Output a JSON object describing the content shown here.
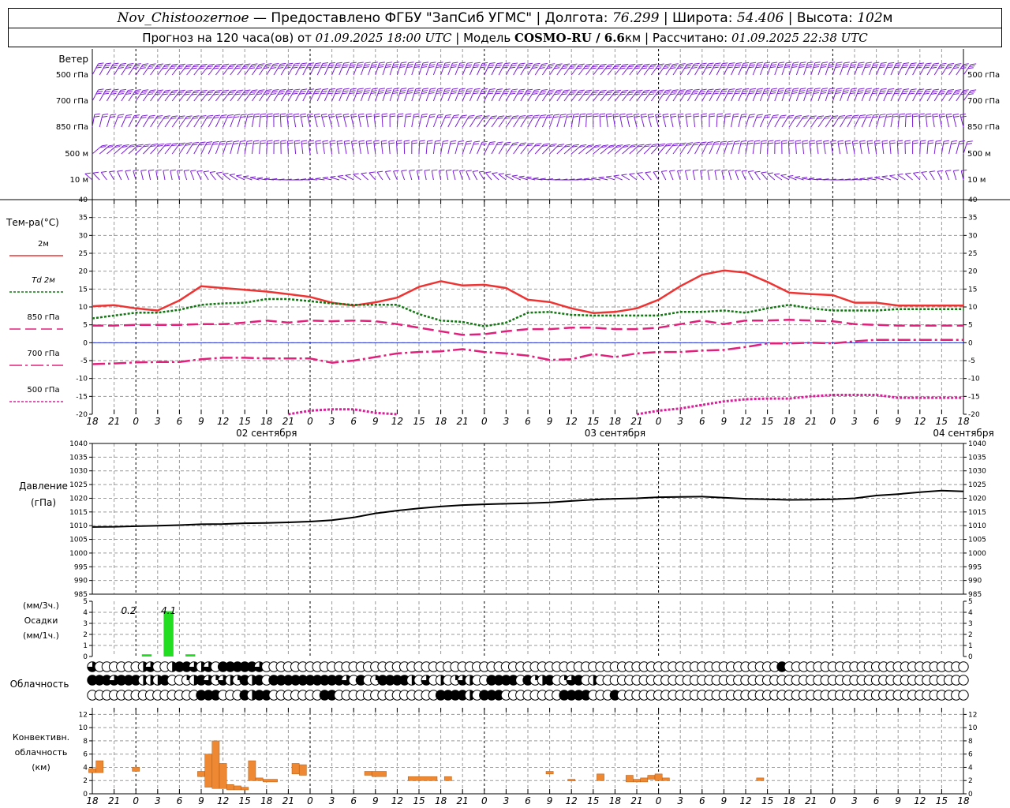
{
  "header": {
    "station": "Nov_Chistoozernoe",
    "provider": "— Предоставлено ФГБУ \"ЗапСиб УГМС\"",
    "lon_label": "Долгота:",
    "lon_value": "76.299",
    "lat_label": "Широта:",
    "lat_value": "54.406",
    "alt_label": "Высота:",
    "alt_value": "102",
    "alt_unit": "м",
    "forecast_label": "Прогноз на 120 часа(ов) от",
    "forecast_time": "01.09.2025 18:00 UTC",
    "model_label": "Модель",
    "model_name": "COSMO-RU / 6.6",
    "model_unit": "км",
    "calc_label": "Рассчитано:",
    "calc_time": "01.09.2025 22:38 UTC"
  },
  "labels": {
    "wind_title": "Ветер",
    "wind_levels": [
      "500 гПа",
      "700 гПа",
      "850 гПа",
      "500 м",
      "10 м"
    ],
    "temp_title": "Тем-ра(°C)",
    "temp_legend": [
      "2м",
      "Td 2м",
      "850 гПа",
      "700 гПа",
      "500 гПа"
    ],
    "press_title": [
      "Давление",
      "(гПа)"
    ],
    "precip_title": [
      "(мм/3ч.)",
      "Осадки",
      "(мм/1ч.)"
    ],
    "precip_values": [
      "0.2",
      "4.1"
    ],
    "cloud_title": "Облачность",
    "conv_title": [
      "Конвективн.",
      "облачность",
      "(км)"
    ],
    "date_labels": [
      "02 сентября",
      "03 сентября",
      "04 сентября"
    ]
  },
  "colors": {
    "wind": "#7b1fd6",
    "t2m": "#ee3333",
    "td2m": "#117711",
    "t850": "#e0207a",
    "t700": "#e0207a",
    "t500": "#d8209a",
    "zero": "#2233cc",
    "pressure": "#000000",
    "precip": "#22dd22",
    "conv": "#ee8833"
  },
  "chart_data": [
    {
      "type": "line",
      "title": "Тем-ра(°C)",
      "x_hours": [
        0,
        3,
        6,
        9,
        12,
        15,
        18,
        21,
        24,
        27,
        30,
        33,
        36,
        39,
        42,
        45,
        48,
        51,
        54,
        57,
        60,
        63,
        66,
        69,
        72,
        75,
        78,
        81,
        84,
        87,
        90,
        93,
        96,
        99,
        102,
        105,
        108,
        111,
        114,
        117,
        120
      ],
      "x_tick_labels": [
        "18",
        "21",
        "0",
        "3",
        "6",
        "9",
        "12",
        "15",
        "18",
        "21",
        "0",
        "3",
        "6",
        "9",
        "12",
        "15",
        "18",
        "21",
        "0",
        "3",
        "6",
        "9",
        "12",
        "15",
        "18",
        "21",
        "0",
        "3",
        "6",
        "9",
        "12",
        "15",
        "18",
        "21",
        "0",
        "3",
        "6",
        "9",
        "12",
        "15",
        "18",
        "21",
        "0"
      ],
      "ylim": [
        -20,
        40
      ],
      "yticks": [
        -20,
        -15,
        -10,
        -5,
        0,
        5,
        10,
        15,
        20,
        25,
        30,
        35,
        40
      ],
      "series": [
        {
          "name": "2м",
          "key": "t2m",
          "dash": "",
          "width": 2.5,
          "values": [
            10.2,
            10.5,
            9.6,
            9.0,
            11.8,
            15.8,
            15.3,
            14.8,
            14.3,
            13.6,
            12.8,
            11.2,
            10.4,
            11.3,
            12.6,
            15.6,
            17.2,
            16.0,
            16.2,
            15.3,
            12.0,
            11.4,
            9.6,
            8.3,
            8.6,
            9.6,
            12.0,
            15.8,
            19.0,
            20.2,
            19.6,
            17.0,
            14.0,
            13.6,
            13.3,
            11.2,
            11.2,
            10.4,
            10.4,
            10.4,
            10.4
          ]
        },
        {
          "name": "Td 2м",
          "key": "td2m",
          "dash": "3,2",
          "width": 2.5,
          "values": [
            6.8,
            7.6,
            8.4,
            8.4,
            9.2,
            10.6,
            11.0,
            11.2,
            12.2,
            12.2,
            11.6,
            11.0,
            10.6,
            10.6,
            10.6,
            8.0,
            6.2,
            5.8,
            4.6,
            5.6,
            8.4,
            8.6,
            7.8,
            7.6,
            7.6,
            7.6,
            7.6,
            8.6,
            8.6,
            9.0,
            8.4,
            9.6,
            10.6,
            9.6,
            9.0,
            9.0,
            9.0,
            9.4,
            9.4,
            9.4,
            9.4
          ]
        },
        {
          "name": "850 гПа",
          "key": "t850",
          "dash": "14,6",
          "width": 2.5,
          "values": [
            4.8,
            4.8,
            5.0,
            5.0,
            5.0,
            5.2,
            5.2,
            5.6,
            6.2,
            5.6,
            6.2,
            6.0,
            6.2,
            6.0,
            5.2,
            4.2,
            3.2,
            2.2,
            2.4,
            3.2,
            3.8,
            3.8,
            4.2,
            4.2,
            3.8,
            3.8,
            4.2,
            5.2,
            6.2,
            5.2,
            6.2,
            6.2,
            6.4,
            6.2,
            6.0,
            5.2,
            5.0,
            4.8,
            4.8,
            4.8,
            4.8
          ]
        },
        {
          "name": "700 гПа",
          "key": "t700",
          "dash": "16,4,3,4",
          "width": 2.5,
          "values": [
            -6.0,
            -5.8,
            -5.5,
            -5.4,
            -5.4,
            -4.6,
            -4.2,
            -4.2,
            -4.4,
            -4.4,
            -4.4,
            -5.6,
            -5.0,
            -4.0,
            -3.0,
            -2.6,
            -2.4,
            -1.8,
            -2.6,
            -3.0,
            -3.6,
            -4.8,
            -4.6,
            -3.2,
            -4.0,
            -3.0,
            -2.6,
            -2.6,
            -2.2,
            -2.0,
            -1.2,
            -0.2,
            -0.2,
            0.0,
            -0.2,
            0.4,
            0.8,
            0.8,
            0.8,
            0.8,
            0.8
          ]
        },
        {
          "name": "500 гПа",
          "key": "t500",
          "dash": "3,2",
          "width": 3,
          "values": [
            null,
            null,
            null,
            null,
            null,
            null,
            null,
            null,
            null,
            -20.0,
            -19.0,
            -18.6,
            -18.6,
            -19.6,
            -20.0,
            null,
            null,
            null,
            null,
            null,
            null,
            null,
            null,
            null,
            null,
            -20.0,
            -19.0,
            -18.4,
            -17.4,
            -16.4,
            -15.8,
            -15.6,
            -15.6,
            -15.0,
            -14.6,
            -14.6,
            -14.6,
            -15.4,
            -15.4,
            -15.4,
            -15.4
          ]
        }
      ]
    },
    {
      "type": "line",
      "title": "Давление (гПа)",
      "x_hours": [
        0,
        3,
        6,
        9,
        12,
        15,
        18,
        21,
        24,
        27,
        30,
        33,
        36,
        39,
        42,
        45,
        48,
        51,
        54,
        57,
        60,
        63,
        66,
        69,
        72,
        75,
        78,
        81,
        84,
        87,
        90,
        93,
        96,
        99,
        102,
        105,
        108,
        111,
        114,
        117,
        120
      ],
      "ylim": [
        985,
        1040
      ],
      "yticks": [
        985,
        990,
        995,
        1000,
        1005,
        1010,
        1015,
        1020,
        1025,
        1030,
        1035,
        1040
      ],
      "series": [
        {
          "name": "",
          "key": "pressure",
          "values": [
            1009.5,
            1009.6,
            1009.8,
            1010.0,
            1010.2,
            1010.5,
            1010.6,
            1010.9,
            1011.0,
            1011.2,
            1011.5,
            1012.0,
            1013.0,
            1014.5,
            1015.5,
            1016.3,
            1017.0,
            1017.5,
            1017.8,
            1018.0,
            1018.2,
            1018.5,
            1019.0,
            1019.5,
            1019.8,
            1020.0,
            1020.4,
            1020.5,
            1020.6,
            1020.2,
            1019.8,
            1019.6,
            1019.4,
            1019.5,
            1019.6,
            1020.0,
            1021.0,
            1021.5,
            1022.2,
            1022.8,
            1022.5
          ]
        }
      ]
    },
    {
      "type": "bar",
      "title": "Осадки",
      "ylim": [
        0,
        5
      ],
      "yticks": [
        0,
        1,
        2,
        3,
        4,
        5
      ],
      "bars": [
        {
          "hour": 7.5,
          "value": 0.2
        },
        {
          "hour": 10.5,
          "value": 4.1
        },
        {
          "hour": 13.5,
          "value": 0.2
        }
      ]
    },
    {
      "type": "bar",
      "title": "Конвективн. облачность (км)",
      "ylim": [
        0,
        13
      ],
      "yticks": [
        0,
        2,
        4,
        6,
        8,
        10,
        12
      ],
      "bars": [
        {
          "hour": 0,
          "w": 1,
          "base": 3.2,
          "top": 3.8
        },
        {
          "hour": 1,
          "w": 1,
          "base": 3.2,
          "top": 5.0
        },
        {
          "hour": 6,
          "w": 1,
          "base": 3.4,
          "top": 4.0
        },
        {
          "hour": 15,
          "w": 1,
          "base": 2.6,
          "top": 3.4
        },
        {
          "hour": 16,
          "w": 1,
          "base": 1.0,
          "top": 6.0
        },
        {
          "hour": 17,
          "w": 1,
          "base": 0.8,
          "top": 8.0
        },
        {
          "hour": 18,
          "w": 1,
          "base": 0.8,
          "top": 4.6
        },
        {
          "hour": 19,
          "w": 1,
          "base": 0.6,
          "top": 1.4
        },
        {
          "hour": 20,
          "w": 1,
          "base": 0.6,
          "top": 1.2
        },
        {
          "hour": 21,
          "w": 1,
          "base": 0.6,
          "top": 1.0
        },
        {
          "hour": 22,
          "w": 1,
          "base": 2.0,
          "top": 5.0
        },
        {
          "hour": 23,
          "w": 1,
          "base": 2.0,
          "top": 2.4
        },
        {
          "hour": 24,
          "w": 2,
          "base": 1.8,
          "top": 2.2
        },
        {
          "hour": 28,
          "w": 1,
          "base": 3.0,
          "top": 4.6
        },
        {
          "hour": 29,
          "w": 1,
          "base": 2.8,
          "top": 4.4
        },
        {
          "hour": 38,
          "w": 1,
          "base": 2.8,
          "top": 3.4
        },
        {
          "hour": 39,
          "w": 2,
          "base": 2.6,
          "top": 3.4
        },
        {
          "hour": 44,
          "w": 4,
          "base": 2.0,
          "top": 2.6
        },
        {
          "hour": 49,
          "w": 1,
          "base": 2.0,
          "top": 2.6
        },
        {
          "hour": 63,
          "w": 1,
          "base": 3.0,
          "top": 3.4
        },
        {
          "hour": 66,
          "w": 1,
          "base": 2.0,
          "top": 2.2
        },
        {
          "hour": 70,
          "w": 1,
          "base": 2.0,
          "top": 3.0
        },
        {
          "hour": 74,
          "w": 1,
          "base": 1.8,
          "top": 2.8
        },
        {
          "hour": 75,
          "w": 1,
          "base": 1.8,
          "top": 2.2
        },
        {
          "hour": 76,
          "w": 1,
          "base": 1.8,
          "top": 2.4
        },
        {
          "hour": 77,
          "w": 1,
          "base": 2.2,
          "top": 2.8
        },
        {
          "hour": 78,
          "w": 1,
          "base": 2.0,
          "top": 3.0
        },
        {
          "hour": 79,
          "w": 1,
          "base": 2.0,
          "top": 2.4
        },
        {
          "hour": 92,
          "w": 1,
          "base": 2.0,
          "top": 2.4
        }
      ]
    }
  ],
  "clouds": {
    "rows": [
      "3000000230024432304444430000000000000000000000000000000000000000000000000000000000000000000000040000000000000000000000000000000444",
      "4443444222400124313214240444444444430401444420302013200444404124013402000000000000000000000000000000000000000000000000000000044400",
      "0000000000000004440004244000000044000000000000004444204440000000044440004000000000000000000000000000000000000000000000000000000004"
    ]
  }
}
